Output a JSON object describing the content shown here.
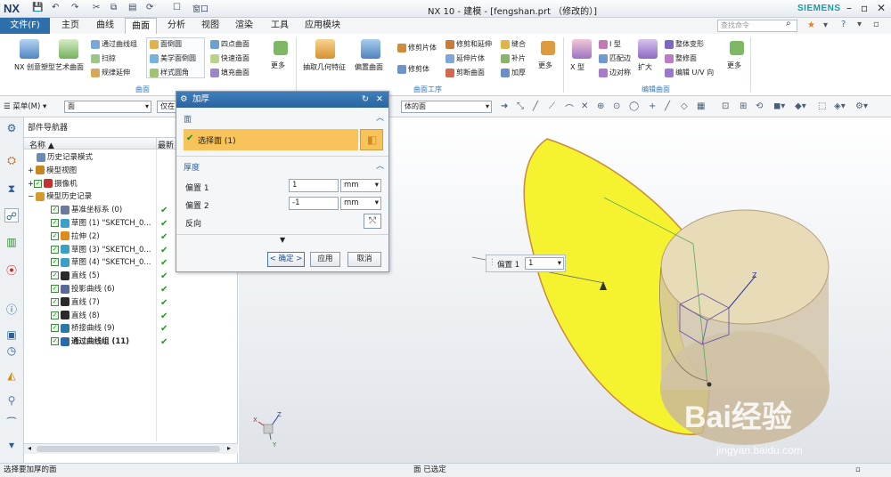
{
  "titlebar": {
    "logo": "NX",
    "window_menu": "窗口",
    "title": "NX 10 - 建模 - [fengshan.prt （修改的）]",
    "brand": "SIEMENS",
    "min": "–",
    "max": "▫",
    "close": "✕"
  },
  "menubar": {
    "file": "文件(F)",
    "tabs": [
      "主页",
      "曲线",
      "曲面",
      "分析",
      "视图",
      "渲染",
      "工具",
      "应用模块"
    ],
    "active_index": 2,
    "search_placeholder": "查找命令"
  },
  "ribbon": {
    "big1": "NX 创意塑型",
    "big2": "艺术曲面",
    "col1": [
      "通过曲线组",
      "扫掠",
      "规律延伸"
    ],
    "col2": [
      "面倒圆",
      "美学面倒圆",
      "样式圆角"
    ],
    "col3": [
      "四点曲面",
      "快速造面",
      "填充曲面"
    ],
    "more": "更多",
    "big3": "抽取几何特征",
    "big4": "偏置曲面",
    "col4": [
      "修剪片体",
      "修剪体"
    ],
    "col5": [
      "修剪和延伸",
      "延伸片体",
      "剪断曲面"
    ],
    "col6": [
      "缝合",
      "补片",
      "加厚"
    ],
    "big5": "X 型",
    "col7": [
      "I 型",
      "匹配边",
      "边对称"
    ],
    "big6": "扩大",
    "col8": [
      "整体变形",
      "整修面",
      "编辑 U/V 向"
    ],
    "groups": [
      "曲面",
      "曲面工序",
      "编辑曲面"
    ]
  },
  "toolbar2": {
    "menu": "菜单(M)",
    "filter1": "面",
    "filter2": "仅在",
    "filter3": "体的面"
  },
  "navigator": {
    "title": "部件导航器",
    "col_name": "名称",
    "col_latest": "最新",
    "rows": [
      {
        "label": "历史记录模式",
        "indent": 0,
        "check": false,
        "ok": false,
        "bold": false
      },
      {
        "label": "模型视图",
        "indent": 0,
        "check": false,
        "ok": false,
        "bold": false
      },
      {
        "label": "摄像机",
        "indent": 0,
        "check": true,
        "ok": false,
        "bold": false
      },
      {
        "label": "模型历史记录",
        "indent": 0,
        "check": false,
        "ok": false,
        "bold": false
      },
      {
        "label": "基准坐标系 (0)",
        "indent": 1,
        "check": true,
        "ok": true,
        "bold": false
      },
      {
        "label": "草图 (1) \"SKETCH_0...",
        "indent": 1,
        "check": true,
        "ok": true,
        "bold": false
      },
      {
        "label": "拉伸 (2)",
        "indent": 1,
        "check": true,
        "ok": true,
        "bold": false
      },
      {
        "label": "草图 (3) \"SKETCH_0...",
        "indent": 1,
        "check": true,
        "ok": true,
        "bold": false
      },
      {
        "label": "草图 (4) \"SKETCH_0...",
        "indent": 1,
        "check": true,
        "ok": true,
        "bold": false
      },
      {
        "label": "直线 (5)",
        "indent": 1,
        "check": true,
        "ok": true,
        "bold": false
      },
      {
        "label": "投影曲线 (6)",
        "indent": 1,
        "check": true,
        "ok": true,
        "bold": false
      },
      {
        "label": "直线 (7)",
        "indent": 1,
        "check": true,
        "ok": true,
        "bold": false
      },
      {
        "label": "直线 (8)",
        "indent": 1,
        "check": true,
        "ok": true,
        "bold": false
      },
      {
        "label": "桥接曲线 (9)",
        "indent": 1,
        "check": true,
        "ok": true,
        "bold": false
      },
      {
        "label": "通过曲线组 (11)",
        "indent": 1,
        "check": true,
        "ok": true,
        "bold": true
      }
    ]
  },
  "dialog": {
    "title": "加厚",
    "section_face": "面",
    "select_face": "选择面 (1)",
    "section_thickness": "厚度",
    "offset1_label": "偏置 1",
    "offset1_value": "1",
    "offset1_unit": "mm",
    "offset2_label": "偏置 2",
    "offset2_value": "-1",
    "offset2_unit": "mm",
    "reverse_label": "反向",
    "ok": "< 确定 >",
    "apply": "应用",
    "cancel": "取消"
  },
  "canvas": {
    "float_label": "偏置 1",
    "float_value": "1",
    "axis_z": "Z",
    "axis_x": "X",
    "axis_y": "Y",
    "watermark_main": "Bai经验",
    "watermark_url": "jingyan.baidu.com"
  },
  "status": {
    "left": "选择要加厚的面",
    "center": "面 已选定"
  },
  "colors": {
    "accent": "#2d6faa",
    "face_yellow": "#f5f230",
    "selection_bar": "#f7c35a"
  }
}
